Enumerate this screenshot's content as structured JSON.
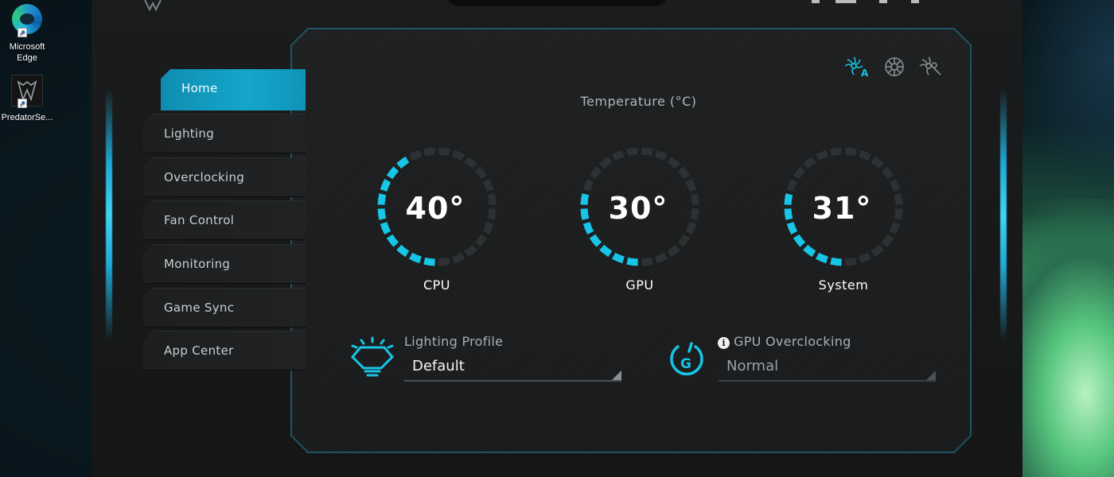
{
  "desktop": {
    "icons": [
      {
        "label_line1": "Microsoft",
        "label_line2": "Edge",
        "icon": "edge-icon"
      },
      {
        "label_line1": "PredatorSe...",
        "label_line2": "",
        "icon": "predator-sense-icon"
      }
    ]
  },
  "sidebar": {
    "items": [
      {
        "label": "Home",
        "active": true
      },
      {
        "label": "Lighting",
        "active": false
      },
      {
        "label": "Overclocking",
        "active": false
      },
      {
        "label": "Fan Control",
        "active": false
      },
      {
        "label": "Monitoring",
        "active": false
      },
      {
        "label": "Game Sync",
        "active": false
      },
      {
        "label": "App Center",
        "active": false
      }
    ]
  },
  "fan_modes": [
    "fan-auto-icon",
    "fan-max-icon",
    "fan-custom-icon"
  ],
  "temperature": {
    "title": "Temperature (°C)",
    "gauges": [
      {
        "label": "CPU",
        "value": "40°",
        "level": 0.4
      },
      {
        "label": "GPU",
        "value": "30°",
        "level": 0.3
      },
      {
        "label": "System",
        "value": "31°",
        "level": 0.31
      }
    ]
  },
  "lighting_profile": {
    "label": "Lighting Profile",
    "value": "Default",
    "icon": "lighting-profile-icon"
  },
  "gpu_overclocking": {
    "label": "GPU Overclocking",
    "value": "Normal",
    "icon": "gpu-overclock-icon",
    "info_icon": "info-icon"
  },
  "colors": {
    "accent": "#17c5e6",
    "active_tab": "#15a6cc",
    "gauge_track": "#2e3133",
    "panel_bg": "#1c1e1f"
  }
}
